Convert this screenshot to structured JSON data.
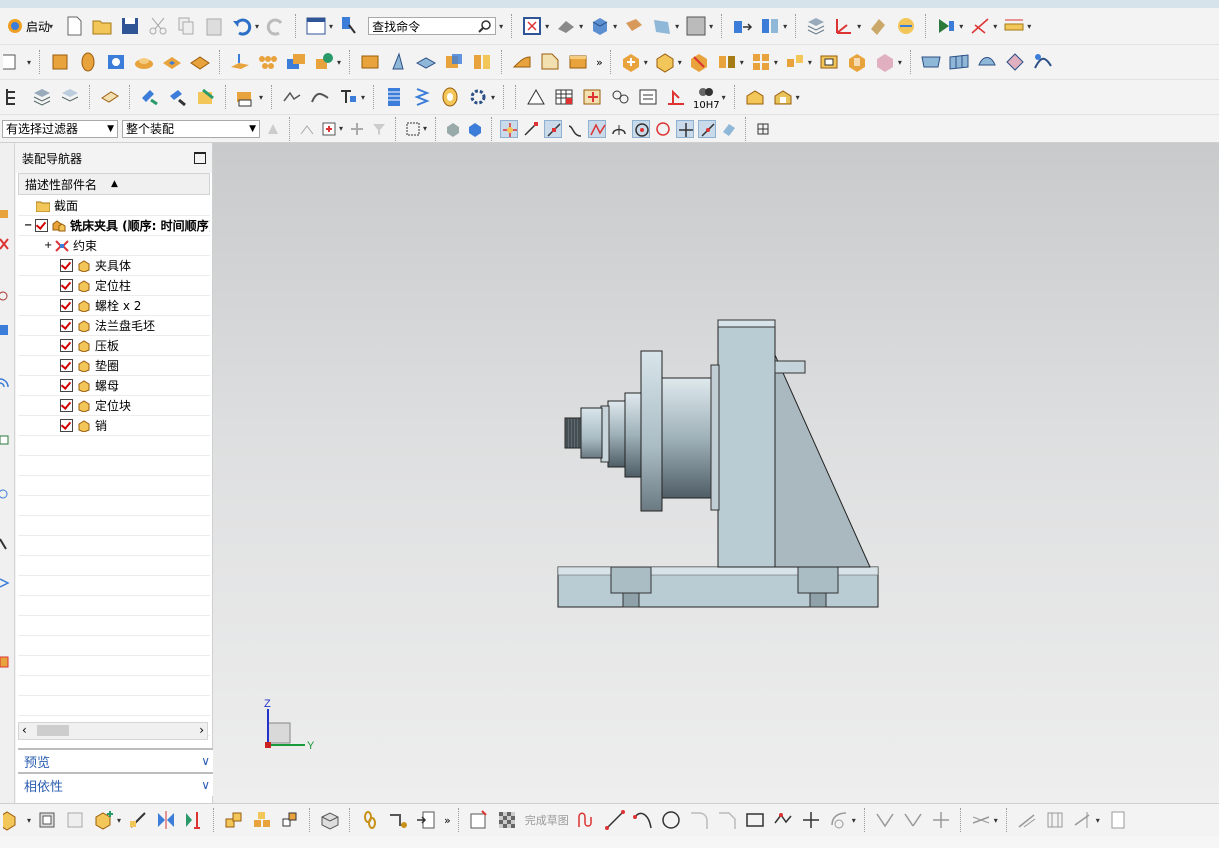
{
  "toolbar": {
    "start_label": "启动",
    "search_placeholder": "查找命令",
    "selection_filter": "有选择过滤器",
    "scope": "整个装配",
    "tolerance_label": "10H7"
  },
  "navigator": {
    "title": "装配导航器",
    "column_header": "描述性部件名",
    "items": [
      {
        "label": "截面"
      },
      {
        "label": "铣床夹具 (顺序: 时间顺序)"
      },
      {
        "label": "约束"
      },
      {
        "label": "夹具体"
      },
      {
        "label": "定位柱"
      },
      {
        "label": "螺栓 x 2"
      },
      {
        "label": "法兰盘毛坯"
      },
      {
        "label": "压板"
      },
      {
        "label": "垫圈"
      },
      {
        "label": "螺母"
      },
      {
        "label": "定位块"
      },
      {
        "label": "销"
      }
    ],
    "preview_label": "预览",
    "dependency_label": "相依性"
  },
  "bottombar": {
    "finish_sketch_label": "完成草图"
  },
  "triad": {
    "z_label": "Z",
    "y_label": "Y"
  },
  "colors": {
    "viewport_top": "#c8cacb",
    "viewport_bottom": "#eeeeee",
    "part_steel": "#b9cbd3",
    "link_blue": "#2a5db0",
    "check_red": "#d40000"
  }
}
